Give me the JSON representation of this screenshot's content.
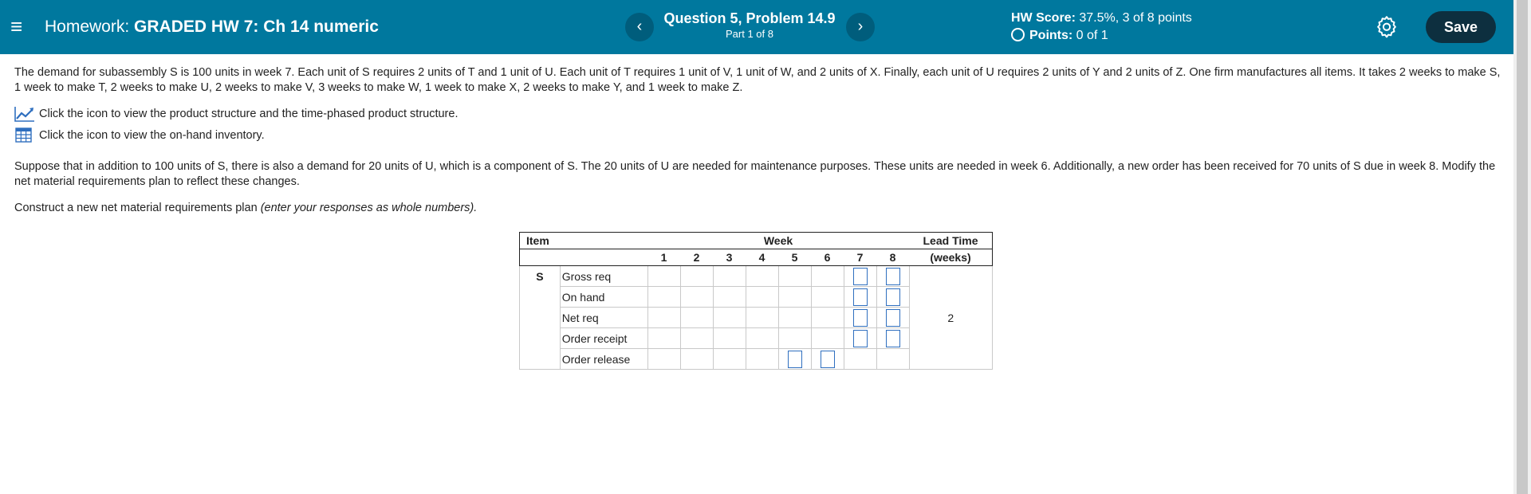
{
  "header": {
    "homework_label": "Homework:",
    "homework_title": "GRADED HW 7: Ch 14 numeric",
    "prev_symbol": "‹",
    "next_symbol": "›",
    "question_title": "Question 5, Problem 14.9",
    "question_part": "Part 1 of 8",
    "hw_score_label": "HW Score:",
    "hw_score_value": "37.5%, 3 of 8 points",
    "points_label": "Points:",
    "points_value": "0 of 1",
    "save_label": "Save",
    "menu_symbol": "≡"
  },
  "problem": {
    "intro": "The demand for subassembly S is 100 units in week 7. Each unit of S requires 2 units of T and 1 unit of U. Each unit of T requires 1 unit of V, 1 unit of W, and 2 units of X. Finally, each unit of U requires 2 units of Y and 2 units of Z. One firm manufactures all items. It takes 2 weeks to make S, 1 week to make T, 2 weeks to make U, 2 weeks to make V, 3 weeks to make W, 1 week to make X, 2 weeks to make Y, and 1 week to make Z.",
    "link_structure": "Click the icon to view the product structure and the time-phased product structure.",
    "link_inventory": "Click the icon to view the on-hand inventory.",
    "scenario": "Suppose that in addition to 100 units of S, there is also a demand for 20 units of U, which is a component of S. The 20 units of U are needed for maintenance purposes. These units are needed in week 6. Additionally, a new order has been received for 70 units of S due in week 8. Modify the net material requirements plan to reflect these changes.",
    "instruction": "Construct a new net material requirements plan",
    "instruction_note": "(enter your responses as whole numbers)."
  },
  "table": {
    "item_header": "Item",
    "week_header": "Week",
    "lead_header": "Lead Time",
    "lead_unit": "(weeks)",
    "weeks": [
      "1",
      "2",
      "3",
      "4",
      "5",
      "6",
      "7",
      "8"
    ],
    "item": "S",
    "lead_time": "2",
    "rows": [
      "Gross req",
      "On hand",
      "Net req",
      "Order receipt",
      "Order release"
    ]
  },
  "colors": {
    "header_bg": "#00789e",
    "save_bg": "#0d2f3f",
    "input_border": "#2f6fbf"
  },
  "icons": [
    "menu-icon",
    "chevron-left-icon",
    "chevron-right-icon",
    "radio-icon",
    "gear-icon",
    "chart-icon",
    "table-icon"
  ]
}
